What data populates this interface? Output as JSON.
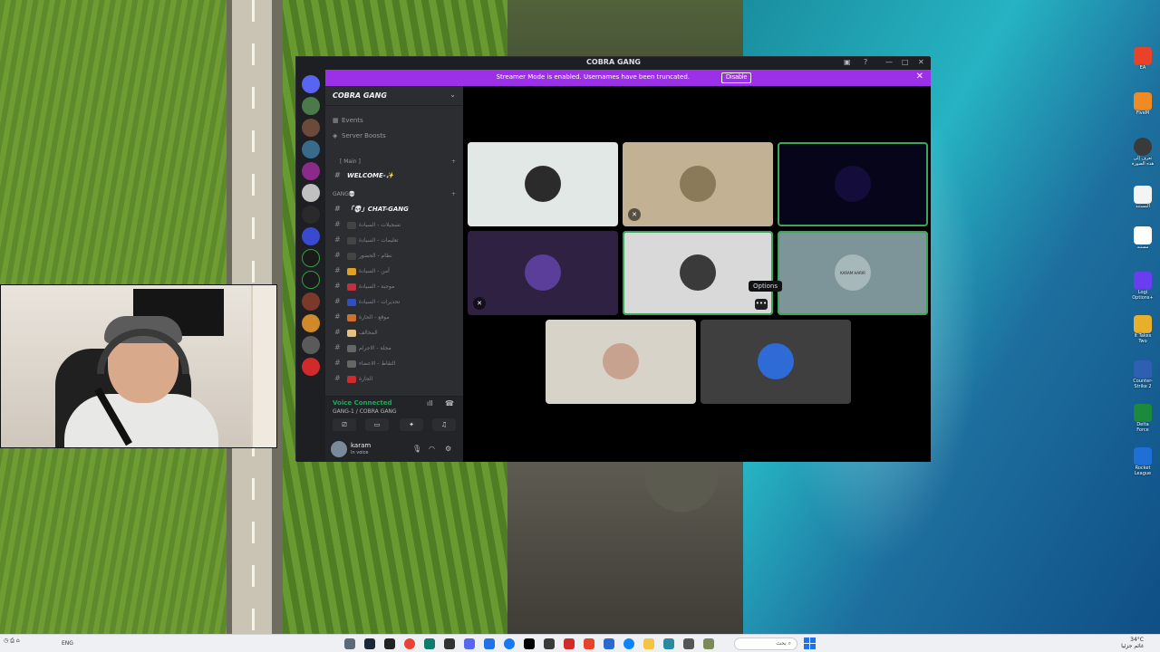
{
  "window": {
    "title": "COBRA GANG"
  },
  "banner": {
    "message": "Streamer Mode is enabled. Usernames have been truncated.",
    "disable_label": "Disable"
  },
  "server": {
    "name": "COBRA GANG",
    "menu": [
      "Events",
      "Server Boosts"
    ],
    "category_main": "[ Main ]",
    "welcome_channel": "WELCOME-✨",
    "category_gang": "GANG💀",
    "chat_channel": "「💀」CHAT-GANG",
    "channels": [
      "تسجيلات - السيادة",
      "تعليمات - السيادة",
      "نظام - الحضور",
      "أمن - السيادة",
      "موجبة - السيادة",
      "تحذيرات - السيادة",
      "موقع - الحارة",
      "المخالف",
      "مجلة - الاجرام",
      "التقاط - الاعضاء",
      "الحارة"
    ]
  },
  "voice": {
    "status": "Voice Connected",
    "channel": "GANG-1 / COBRA GANG"
  },
  "user": {
    "name": "karam",
    "status": "In voice"
  },
  "call": {
    "tooltip": "Options",
    "tile_label": "KARAM HARIR"
  },
  "desktop_icons": [
    {
      "label": "EA",
      "color": "#e8432a"
    },
    {
      "label": "FiveM",
      "color": "#f08a24"
    },
    {
      "label": "تعرف إلى هذه الصورة",
      "color": "#3a3a3a"
    },
    {
      "label": "المستند",
      "color": "#f4f4f4"
    },
    {
      "label": "مستند",
      "color": "#ffffff"
    },
    {
      "label": "Logi Options+",
      "color": "#6a3df0"
    },
    {
      "label": "It Takes Two",
      "color": "#e8b02a"
    },
    {
      "label": "Counter-Strike 2",
      "color": "#2e5fb0"
    },
    {
      "label": "Delta Force",
      "color": "#1c8a3a"
    },
    {
      "label": "Rocket League",
      "color": "#1f6fd6"
    }
  ],
  "taskbar": {
    "lang": "ENG",
    "search_placeholder": "بحث",
    "time": "34°C",
    "date": "غائم جزئيا"
  },
  "colors": {
    "accent": "#9b30e8",
    "speaking": "#3ba55c",
    "voice_connected": "#23a55a"
  }
}
